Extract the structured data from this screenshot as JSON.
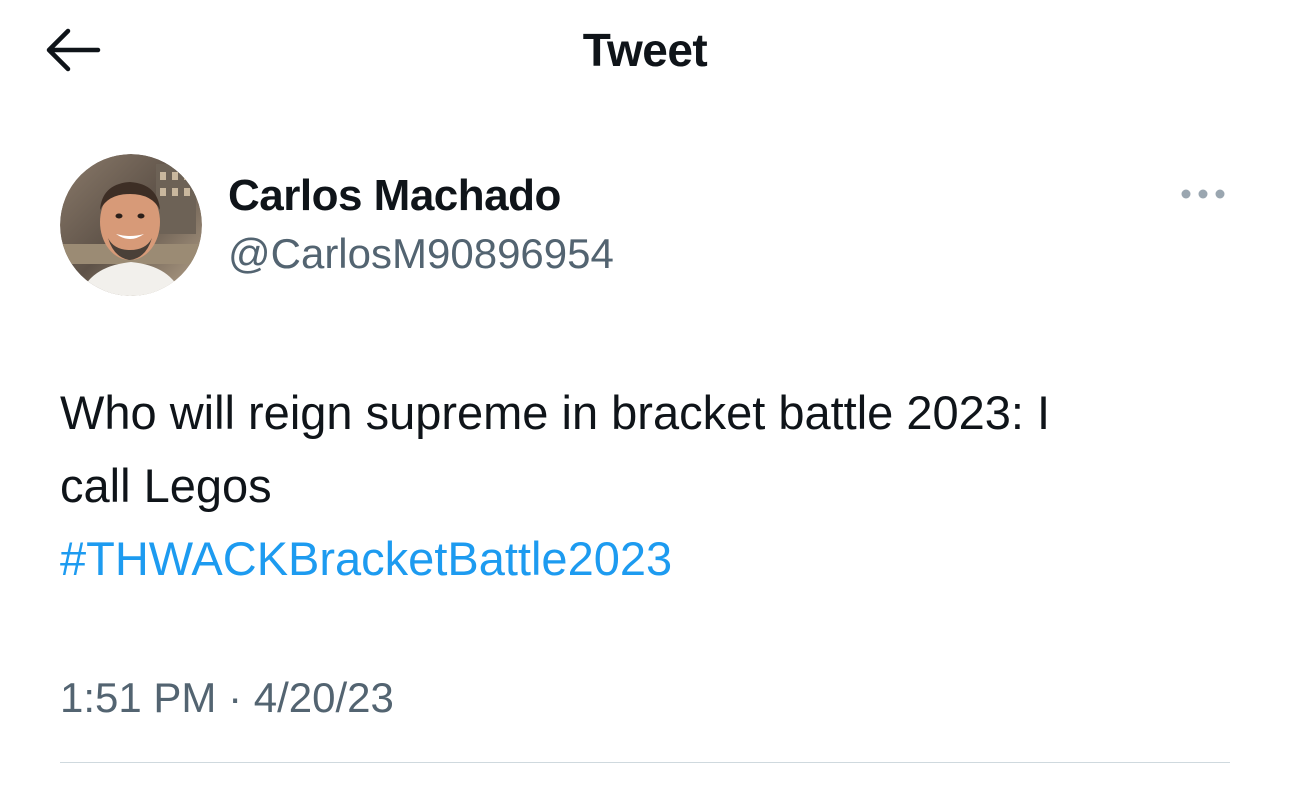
{
  "header": {
    "title": "Tweet",
    "back_icon": "arrow-left-icon"
  },
  "tweet": {
    "author": {
      "display_name": "Carlos Machado",
      "handle": "@CarlosM90896954",
      "avatar": "profile-photo"
    },
    "more_icon": "ellipsis-horizontal-icon",
    "text": {
      "line1": "Who will reign supreme in bracket battle 2023: I",
      "line2": "call Legos",
      "hashtag": "#THWACKBracketBattle2023"
    },
    "time": "1:51 PM",
    "separator": "·",
    "date": "4/20/23"
  },
  "colors": {
    "primary_text": "#0f1419",
    "secondary_text": "#536471",
    "link": "#1d9bf0",
    "divider": "#cfd9de",
    "background": "#ffffff"
  }
}
